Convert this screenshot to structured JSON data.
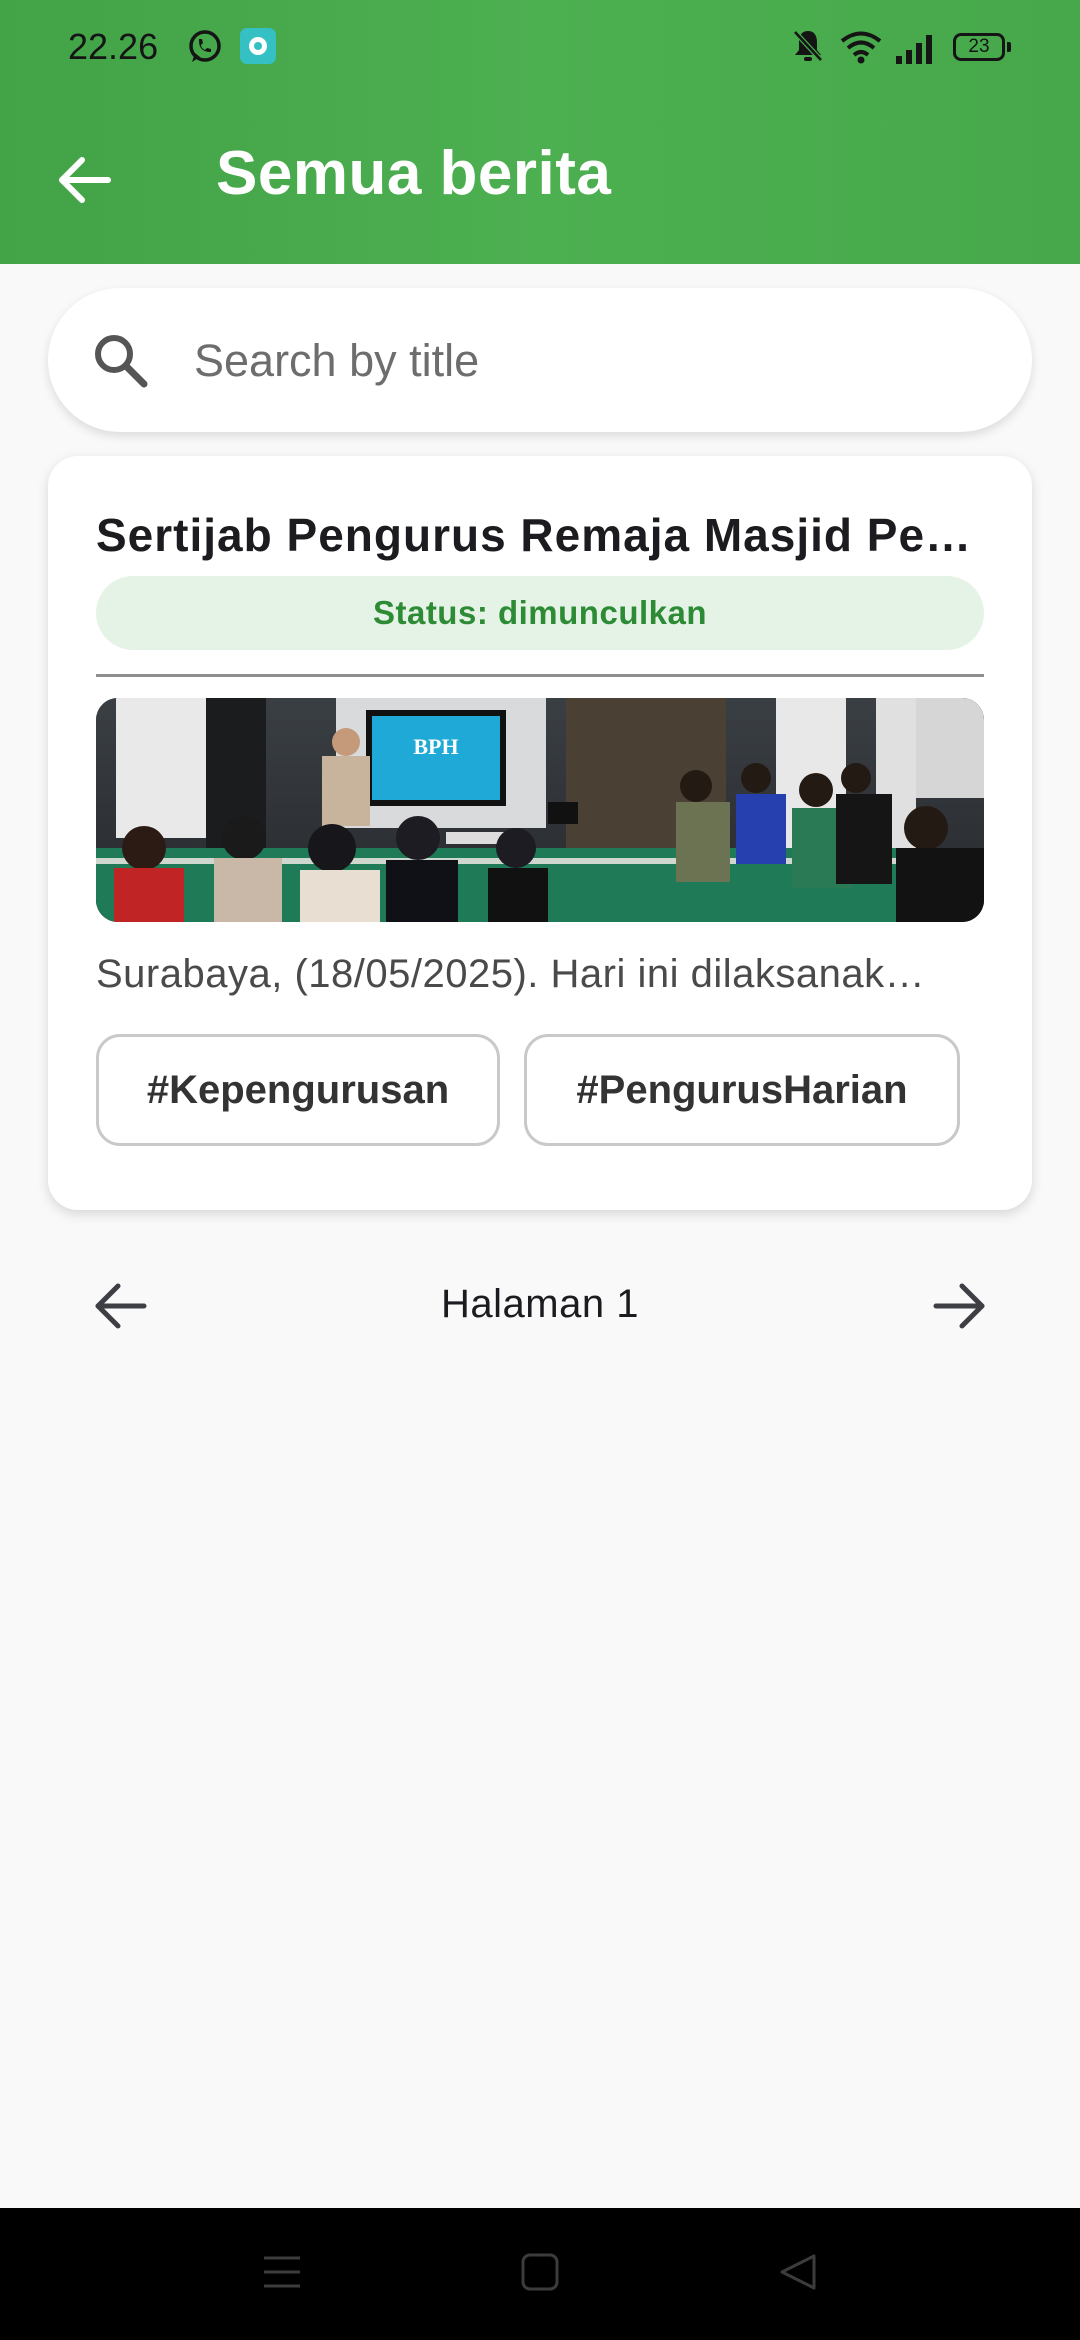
{
  "status_bar": {
    "time": "22.26",
    "battery": "23",
    "icons": [
      "whatsapp-icon",
      "chat-app-icon",
      "bell-off-icon",
      "wifi-icon",
      "signal-icon",
      "battery-icon"
    ]
  },
  "app_bar": {
    "title": "Semua berita",
    "back_icon": "arrow-back-icon",
    "background": "#4caf50"
  },
  "search": {
    "placeholder": "Search by title",
    "value": "",
    "icon": "search-icon"
  },
  "news": [
    {
      "title": "Sertijab Pengurus Remaja Masjid Pe…",
      "status": "Status: dimunculkan",
      "excerpt": "Surabaya, (18/05/2025). Hari ini dilaksanak…",
      "image_screen_text": "BPH",
      "tags": [
        "#Kepengurusan",
        "#PengurusHarian"
      ]
    }
  ],
  "pagination": {
    "label": "Halaman 1",
    "prev_icon": "arrow-left-icon",
    "next_icon": "arrow-right-icon"
  },
  "nav_bar": {
    "icons": [
      "menu-icon",
      "home-icon",
      "back-triangle-icon"
    ]
  },
  "colors": {
    "primary_green": "#4caf50",
    "status_text": "#2e8b35",
    "status_bg": "#e5f3e6",
    "background": "#f9f9f9"
  }
}
